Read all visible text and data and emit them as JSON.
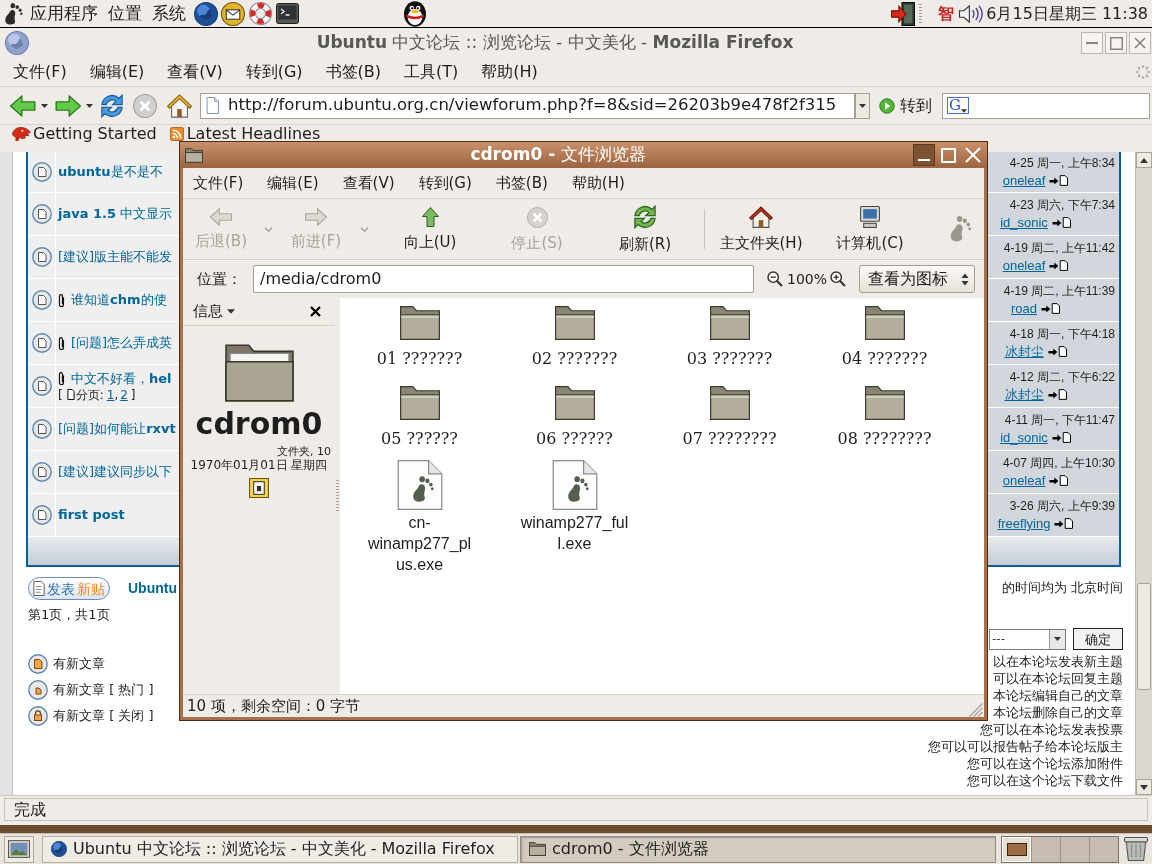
{
  "top_panel": {
    "menus": [
      "应用程序",
      "位置",
      "系统"
    ],
    "input_method": "智",
    "clock": "6月15日星期三 11:38"
  },
  "browser": {
    "title": "**Ubuntu** 中文论坛 :: 浏览论坛 - 中文美化 - **Mozilla Firefox**",
    "menu": [
      "文件(F)",
      "编辑(E)",
      "查看(V)",
      "转到(G)",
      "书签(B)",
      "工具(T)",
      "帮助(H)"
    ],
    "url": "http://forum.ubuntu.org.cn/viewforum.php?f=8&sid=26203b9e478f2f315",
    "go_button": "转到",
    "search_engine": "G",
    "bookmarks": [
      {
        "label": "Getting Started",
        "kind": "page"
      },
      {
        "label": "Latest Headlines",
        "kind": "feed"
      }
    ],
    "status": "完成"
  },
  "forum": {
    "topics": [
      {
        "title": "**ubuntu**是不是不",
        "attachment": false,
        "last_post_time": "4-25 周一, 上午8:34",
        "last_poster": "oneleaf"
      },
      {
        "title": "**java 1.5** 中文显示",
        "attachment": false,
        "last_post_time": "4-23 周六, 下午7:34",
        "last_poster": "id_sonic"
      },
      {
        "title": "[建议]版主能不能发",
        "attachment": false,
        "last_post_time": "4-19 周二, 上午11:42",
        "last_poster": "oneleaf"
      },
      {
        "title": "谁知道**chm**的使",
        "attachment": true,
        "last_post_time": "4-19 周二, 上午11:39",
        "last_poster": "road"
      },
      {
        "title": "[问题]怎么弄成英",
        "attachment": true,
        "last_post_time": "4-18 周一, 下午4:18",
        "last_poster": "冰封尘"
      },
      {
        "title": "中文不好看，**hel**",
        "attachment": true,
        "pagination": {
          "open": "[",
          "label": "分页:",
          "pages": [
            "1",
            "2"
          ],
          "separator": ",",
          "close": "]"
        },
        "last_post_time": "4-12 周二, 下午6:22",
        "last_poster": "冰封尘"
      },
      {
        "title": "[问题]如何能让**rxvt**",
        "attachment": false,
        "last_post_time": "4-11 周一, 下午11:47",
        "last_poster": "id_sonic"
      },
      {
        "title": "[建议]建议同步以下",
        "attachment": false,
        "last_post_time": "4-07 周四, 上午10:30",
        "last_poster": "oneleaf"
      },
      {
        "title": "**first post**",
        "attachment": false,
        "last_post_time": "3-26 周六, 上午9:39",
        "last_poster": "freeflying"
      }
    ],
    "new_topic_button": {
      "label": "发表",
      "highlight": "新贴"
    },
    "breadcrumb": "Ubuntu",
    "timezone_note": "的时间均为 北京时间",
    "page_info": "第1页，共1页",
    "jump": {
      "value": "---",
      "button": "确定"
    },
    "legend": [
      {
        "kind": "new",
        "label": "有新文章"
      },
      {
        "kind": "hot",
        "label": "有新文章 [ 热门 ]"
      },
      {
        "kind": "locked",
        "label": "有新文章 [ 关闭 ]"
      }
    ],
    "permissions": [
      "以在本论坛发表新主题",
      "可以在本论坛回复主题",
      "本论坛编辑自己的文章",
      "本论坛删除自己的文章",
      "您可以在本论坛发表投票",
      "您可以可以报告帖子给本论坛版主",
      "您可以在这个论坛添加附件",
      "您可以在这个论坛下载文件"
    ]
  },
  "file_browser": {
    "title": "**cdrom0 -** 文件浏览器",
    "menu": [
      "文件(F)",
      "编辑(E)",
      "查看(V)",
      "转到(G)",
      "书签(B)",
      "帮助(H)"
    ],
    "toolbar": [
      {
        "kind": "back",
        "label": "后退(B)",
        "disabled": true,
        "has_menu": true
      },
      {
        "kind": "forward",
        "label": "前进(F)",
        "disabled": true,
        "has_menu": true
      },
      {
        "kind": "up",
        "label": "向上(U)",
        "disabled": false,
        "has_menu": false
      },
      {
        "kind": "stop",
        "label": "停止(S)",
        "disabled": true,
        "has_menu": false
      },
      {
        "kind": "reload",
        "label": "刷新(R)",
        "disabled": false,
        "has_menu": false
      },
      {
        "kind": "separator"
      },
      {
        "kind": "home",
        "label": "主文件夹(H)",
        "disabled": false,
        "has_menu": false
      },
      {
        "kind": "computer",
        "label": "计算机(C)",
        "disabled": false,
        "has_menu": false
      }
    ],
    "location_label": "位置：",
    "location": "/media/cdrom0",
    "zoom": "100%",
    "view_mode": "查看为图标",
    "side_pane": {
      "title": "信息",
      "name": "cdrom0",
      "info": "文件夹, 10",
      "date": "1970年01月01日 星期四"
    },
    "items": [
      {
        "name": "01 ???????",
        "kind": "folder"
      },
      {
        "name": "02 ???????",
        "kind": "folder"
      },
      {
        "name": "03 ???????",
        "kind": "folder"
      },
      {
        "name": "04 ???????",
        "kind": "folder"
      },
      {
        "name": "05 ??????",
        "kind": "folder"
      },
      {
        "name": "06 ??????",
        "kind": "folder"
      },
      {
        "name": "07 ????????",
        "kind": "folder"
      },
      {
        "name": "08 ????????",
        "kind": "folder"
      },
      {
        "name": "cn-winamp277_plus.exe",
        "kind": "executable"
      },
      {
        "name": "winamp277_full.exe",
        "kind": "executable"
      }
    ],
    "status": "10 项，剩余空间：0 字节"
  },
  "taskbar": {
    "tasks": [
      {
        "label": "Ubuntu 中文论坛 :: 浏览论坛 - 中文美化 - Mozilla Firefox",
        "kind": "browser",
        "selected": false
      },
      {
        "label": "cdrom0 - 文件浏览器",
        "kind": "file-manager",
        "selected": true
      }
    ],
    "workspaces": [
      {
        "selected": true
      },
      {
        "selected": false
      },
      {
        "selected": false
      },
      {
        "selected": false
      }
    ]
  }
}
